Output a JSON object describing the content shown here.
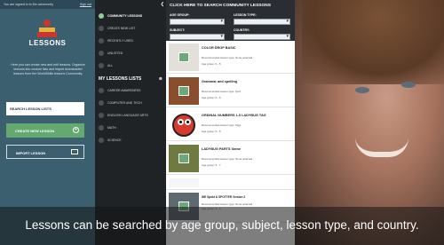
{
  "top_status": {
    "signed_in": "You are signed in to the community",
    "sign_out": "Sign out"
  },
  "brand": {
    "name": "LESSONS"
  },
  "description": "Here you can create new and edit lessons. Organize lessons into custom lists and import downloaded lessons from the WorldSkills lessons Community.",
  "left_actions": {
    "search_lists": "SEARCH LESSON LISTS",
    "create_new": "CREATE NEW LESSON",
    "import": "IMPORT LESSON"
  },
  "nav": {
    "items": [
      {
        "label": "COMMUNITY LESSONS",
        "active": true
      },
      {
        "label": "CREATE NEW LIST"
      },
      {
        "label": "RECENTLY USED"
      },
      {
        "label": "UNLISTED"
      },
      {
        "label": "ALL"
      }
    ],
    "my_lists_header": "MY LESSONS LISTS",
    "my_lists": [
      {
        "label": "CAREER AWARENESS"
      },
      {
        "label": "COMPUTER AND TECH"
      },
      {
        "label": "ENGLISH LANGUAGE ARTS"
      },
      {
        "label": "MATH"
      },
      {
        "label": "SCIENCE"
      }
    ]
  },
  "main": {
    "header": "CLICK HERE TO SEARCH COMMUNITY LESSONS",
    "filters": {
      "age_group": "AGE GROUP:",
      "lesson_type": "LESSON TYPE:",
      "subject": "SUBJECT:",
      "country": "COUNTRY:"
    },
    "cards": [
      {
        "title": "COLOR DROP BASIC",
        "rec": "Recommended lesson type: None selected",
        "age": "Age group: 0 - 5",
        "thumb_color": "#e2e0d8"
      },
      {
        "title": "Grammar and spelling",
        "rec": "Recommended lesson type: Quiz",
        "age": "Age group: 0 - 5",
        "thumb_color": "#8a4e2f"
      },
      {
        "title": "ORDINAL NUMBERS 1-5 LADYBUG TAG",
        "rec": "Recommended lesson type: Tags",
        "age": "Age group: 0 - 5",
        "thumb_color": "#ffffff"
      },
      {
        "title": "LADYBUG PARTS Game",
        "rec": "Recommended lesson type: None selected",
        "age": "Age group: 3 - 7",
        "thumb_color": "#6e7a40"
      },
      {
        "title": "",
        "rec": "",
        "age": "",
        "thumb_color": "#f4f6f7"
      },
      {
        "title": "WE Spokt & SPOTTER Version 2",
        "rec": "Recommended lesson type: None selected",
        "age": "Age group: 3 - 4",
        "thumb_color": "#5d6a72"
      }
    ]
  },
  "caption": "Lessons can be searched by age group, subject, lesson type, and country.",
  "colors": {
    "teal": "#3c5f70",
    "green": "#64a96f",
    "dark": "#202326"
  }
}
